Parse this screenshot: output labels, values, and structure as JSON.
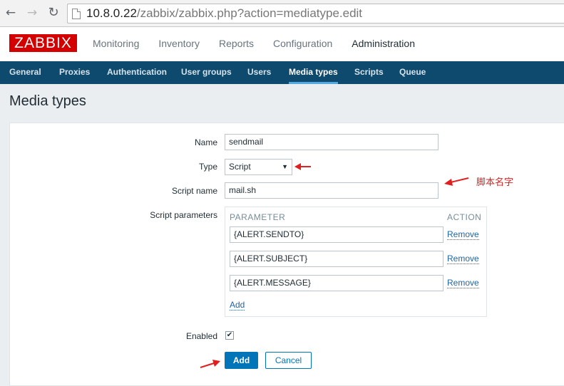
{
  "browser": {
    "url_host": "10.8.0.22",
    "url_path": "/zabbix/zabbix.php?action=mediatype.edit"
  },
  "header": {
    "logo": "ZABBIX",
    "main_menu": [
      "Monitoring",
      "Inventory",
      "Reports",
      "Configuration",
      "Administration"
    ],
    "active_main": "Administration"
  },
  "subnav": {
    "items": [
      "General",
      "Proxies",
      "Authentication",
      "User groups",
      "Users",
      "Media types",
      "Scripts",
      "Queue"
    ],
    "active": "Media types"
  },
  "page": {
    "title": "Media types"
  },
  "form": {
    "name_label": "Name",
    "name_value": "sendmail",
    "type_label": "Type",
    "type_value": "Script",
    "script_name_label": "Script name",
    "script_name_value": "mail.sh",
    "script_params_label": "Script parameters",
    "params_header_parameter": "PARAMETER",
    "params_header_action": "ACTION",
    "params": [
      {
        "value": "{ALERT.SENDTO}",
        "action": "Remove"
      },
      {
        "value": "{ALERT.SUBJECT}",
        "action": "Remove"
      },
      {
        "value": "{ALERT.MESSAGE}",
        "action": "Remove"
      }
    ],
    "add_param_link": "Add",
    "enabled_label": "Enabled",
    "enabled": true,
    "add_button": "Add",
    "cancel_button": "Cancel"
  },
  "annotation": {
    "text": "脚本名字",
    "color": "#e02020"
  },
  "colors": {
    "header_bg": "#0e4a6d",
    "logo_bg": "#d40000",
    "primary": "#0275b8"
  }
}
